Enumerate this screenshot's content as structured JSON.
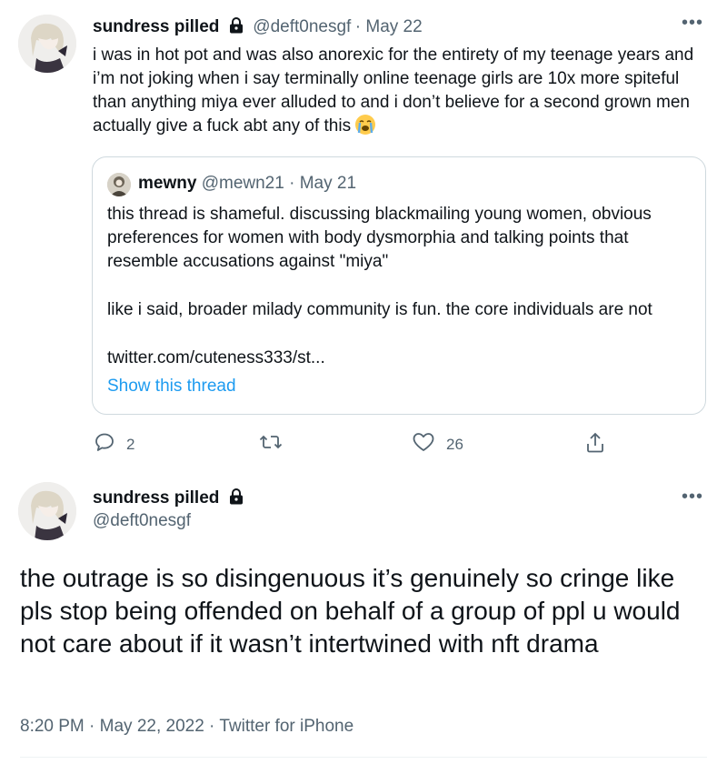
{
  "tweet1": {
    "display_name": "sundress pilled",
    "handle": "@deft0nesgf",
    "date": "May 22",
    "text": "i was in hot pot and was also anorexic for the entirety of my teenage years and i’m not joking when i say terminally online teenage girls are 10x more spiteful than anything miya ever alluded to and i don’t believe for a second grown men actually give a fuck abt any of this",
    "emoji": "loudly-crying-face",
    "quote": {
      "display_name": "mewny",
      "handle": "@mewn21",
      "date": "May 21",
      "para1": "this thread is shameful. discussing blackmailing young women, obvious preferences for women with body dysmorphia and talking points that resemble accusations against \"miya\"",
      "para2": "like i said, broader milady community is fun. the core individuals are not",
      "link": "twitter.com/cuteness333/st...",
      "show_thread": "Show this thread"
    },
    "actions": {
      "replies": "2",
      "retweets": "",
      "likes": "26"
    }
  },
  "tweet2": {
    "display_name": "sundress pilled",
    "handle": "@deft0nesgf",
    "text": "the outrage is so disingenuous it’s genuinely so cringe like pls stop being offended on behalf of a group of ppl u would not care about if it wasn’t intertwined with nft drama",
    "timestamp": "8:20 PM · May 22, 2022 · Twitter for iPhone"
  },
  "colors": {
    "link": "#1d9bf0",
    "muted": "#536471",
    "border": "#cfd9de",
    "text": "#0f1419"
  }
}
